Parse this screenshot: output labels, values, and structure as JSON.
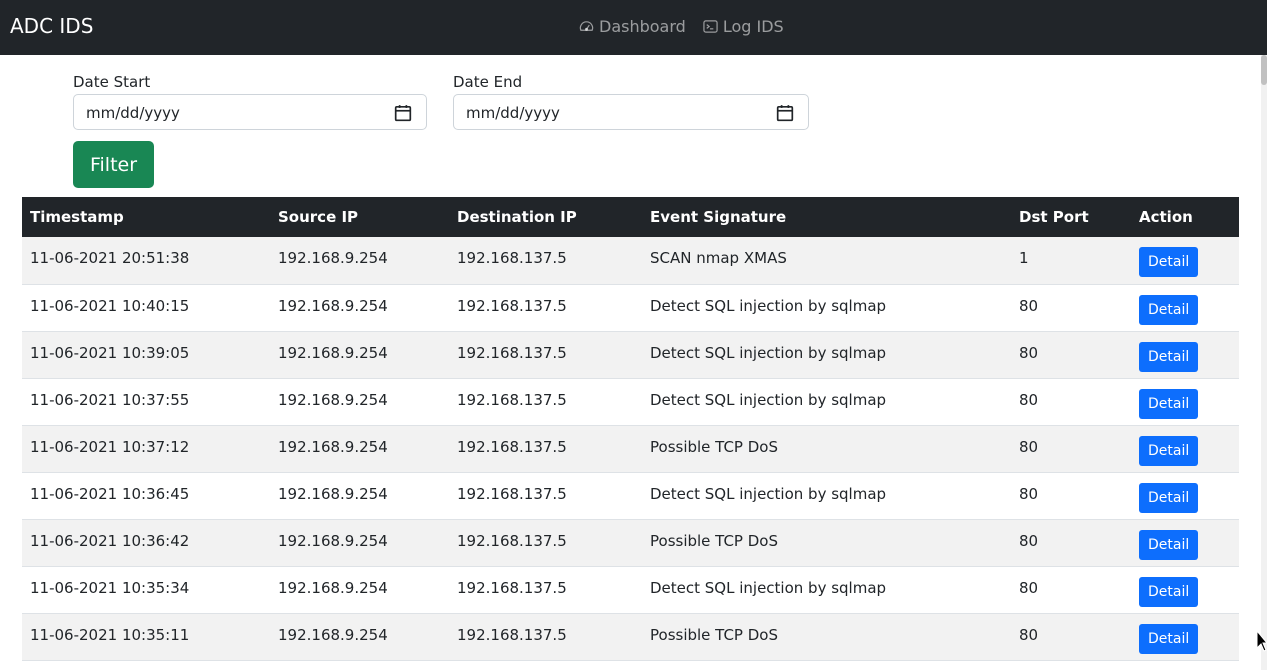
{
  "navbar": {
    "brand": "ADC IDS",
    "links": [
      {
        "label": "Dashboard",
        "icon": "speedometer-icon"
      },
      {
        "label": "Log IDS",
        "icon": "terminal-icon"
      }
    ]
  },
  "filter": {
    "date_start_label": "Date Start",
    "date_start_placeholder": "mm/dd/yyyy",
    "date_end_label": "Date End",
    "date_end_placeholder": "mm/dd/yyyy",
    "button_label": "Filter"
  },
  "table": {
    "headers": [
      "Timestamp",
      "Source IP",
      "Destination IP",
      "Event Signature",
      "Dst Port",
      "Action"
    ],
    "rows": [
      {
        "timestamp": "11-06-2021 20:51:38",
        "src": "192.168.9.254",
        "dst": "192.168.137.5",
        "signature": "SCAN nmap XMAS",
        "port": "1",
        "action": "Detail"
      },
      {
        "timestamp": "11-06-2021 10:40:15",
        "src": "192.168.9.254",
        "dst": "192.168.137.5",
        "signature": "Detect SQL injection by sqlmap",
        "port": "80",
        "action": "Detail"
      },
      {
        "timestamp": "11-06-2021 10:39:05",
        "src": "192.168.9.254",
        "dst": "192.168.137.5",
        "signature": "Detect SQL injection by sqlmap",
        "port": "80",
        "action": "Detail"
      },
      {
        "timestamp": "11-06-2021 10:37:55",
        "src": "192.168.9.254",
        "dst": "192.168.137.5",
        "signature": "Detect SQL injection by sqlmap",
        "port": "80",
        "action": "Detail"
      },
      {
        "timestamp": "11-06-2021 10:37:12",
        "src": "192.168.9.254",
        "dst": "192.168.137.5",
        "signature": "Possible TCP DoS",
        "port": "80",
        "action": "Detail"
      },
      {
        "timestamp": "11-06-2021 10:36:45",
        "src": "192.168.9.254",
        "dst": "192.168.137.5",
        "signature": "Detect SQL injection by sqlmap",
        "port": "80",
        "action": "Detail"
      },
      {
        "timestamp": "11-06-2021 10:36:42",
        "src": "192.168.9.254",
        "dst": "192.168.137.5",
        "signature": "Possible TCP DoS",
        "port": "80",
        "action": "Detail"
      },
      {
        "timestamp": "11-06-2021 10:35:34",
        "src": "192.168.9.254",
        "dst": "192.168.137.5",
        "signature": "Detect SQL injection by sqlmap",
        "port": "80",
        "action": "Detail"
      },
      {
        "timestamp": "11-06-2021 10:35:11",
        "src": "192.168.9.254",
        "dst": "192.168.137.5",
        "signature": "Possible TCP DoS",
        "port": "80",
        "action": "Detail"
      }
    ]
  },
  "colors": {
    "navbar_bg": "#212529",
    "filter_button": "#198754",
    "detail_button": "#0d6efd"
  }
}
